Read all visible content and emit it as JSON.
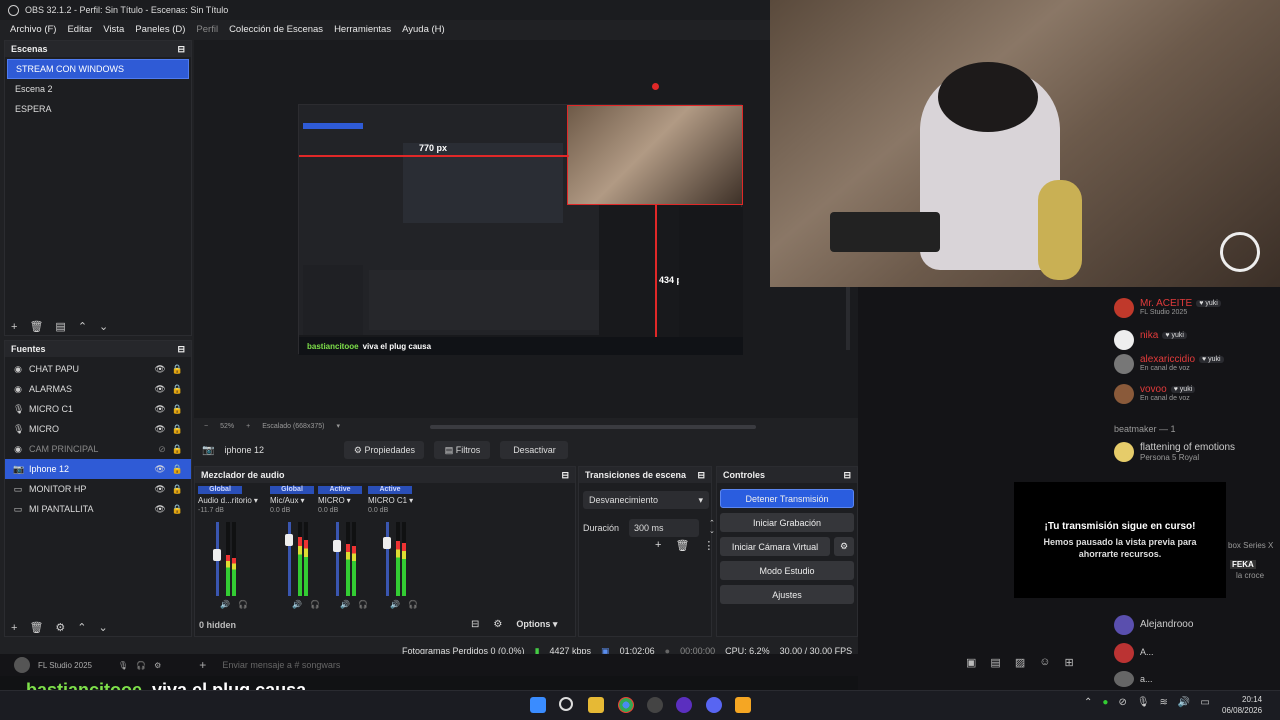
{
  "window": {
    "title": "OBS 32.1.2 - Perfil: Sin Título - Escenas: Sin Título"
  },
  "menu": [
    "Archivo (F)",
    "Editar",
    "Vista",
    "Paneles (D)",
    "Perfil",
    "Colección de Escenas",
    "Herramientas",
    "Ayuda (H)"
  ],
  "scenes": {
    "title": "Escenas",
    "items": [
      "STREAM CON WINDOWS",
      "Escena 2",
      "ESPERA"
    ]
  },
  "sources": {
    "title": "Fuentes",
    "items": [
      {
        "name": "CHAT PAPU",
        "icon": "globe-icon"
      },
      {
        "name": "ALARMAS",
        "icon": "globe-icon"
      },
      {
        "name": "MICRO C1",
        "icon": "mic-icon"
      },
      {
        "name": "MICRO",
        "icon": "mic-icon"
      },
      {
        "name": "CAM PRINCIPAL",
        "icon": "globe-icon"
      },
      {
        "name": "Iphone 12",
        "icon": "camera-icon"
      },
      {
        "name": "MONITOR HP",
        "icon": "monitor-icon"
      },
      {
        "name": "MI PANTALLITA",
        "icon": "monitor-icon"
      }
    ]
  },
  "preview": {
    "zoom": "52%",
    "scale": "Escalado (668x375)",
    "dim_width": "770 px",
    "dim_height": "434 px",
    "chat_user": "bastiancitooe",
    "chat_msg": "viva el plug causa"
  },
  "source_toolbar": {
    "selected": "iphone 12",
    "properties": "Propiedades",
    "filters": "Filtros",
    "deactivate": "Desactivar"
  },
  "mixer": {
    "title": "Mezclador de audio",
    "channels": [
      {
        "tag": "Global",
        "name": "Audio d...ritorio",
        "db": "-11.7 dB",
        "level": 0.55
      },
      {
        "tag": "Global",
        "name": "Mic/Aux",
        "db": "0.0 dB",
        "level": 0.8
      },
      {
        "tag": "Active",
        "name": "MICRO",
        "db": "0.0 dB",
        "level": 0.7
      },
      {
        "tag": "Active",
        "name": "MICRO C1",
        "db": "0.0 dB",
        "level": 0.75
      }
    ],
    "hidden": "0 hidden",
    "options": "Options"
  },
  "transitions": {
    "title": "Transiciones de escena",
    "selected": "Desvanecimiento",
    "duration_label": "Duración",
    "duration": "300 ms"
  },
  "controls": {
    "title": "Controles",
    "stop_stream": "Detener Transmisión",
    "start_record": "Iniciar Grabación",
    "virtual_cam": "Iniciar Cámara Virtual",
    "studio": "Modo Estudio",
    "settings": "Ajustes"
  },
  "status": {
    "dropped": "Fotogramas Perdidos 0 (0.0%)",
    "kbps": "4427 kbps",
    "live_time": "01:02:06",
    "rec_time": "00:00:00",
    "cpu": "CPU: 6.2%",
    "fps": "30.00 / 30.00 FPS"
  },
  "discord": {
    "members": [
      {
        "name": "Mr. ACEITE",
        "tag": "yuki",
        "sub": "FL Studio 2025",
        "color": "#e23b3b"
      },
      {
        "name": "nika",
        "tag": "yuki",
        "sub": "",
        "color": "#e23b3b"
      },
      {
        "name": "alexariccidio",
        "tag": "yuki",
        "sub": "En canal de voz",
        "color": "#e23b3b"
      },
      {
        "name": "vovoo",
        "tag": "yuki",
        "sub": "En canal de voz",
        "color": "#e23b3b"
      }
    ],
    "group": "beatmaker — 1",
    "member_b": {
      "name": "flattening of emotions",
      "sub": "Persona 5 Royal"
    },
    "notice_title": "¡Tu transmisión sigue en curso!",
    "notice_body": "Hemos pausado la vista previa para ahorrarte recursos.",
    "side_label1": "box Series X",
    "side_label2": "FEKA",
    "side_label3": "la croce",
    "member_c": "Alejandrooo",
    "member_d": "A...",
    "member_e": "a...",
    "self_sub": "FL Studio 2025",
    "input_placeholder": "Enviar mensaje a # songwars"
  },
  "overlay": {
    "user": "bastiancitooe",
    "msg": "viva el plug causa"
  },
  "taskbar": {
    "time": "20:14",
    "date": "06/08/2026"
  }
}
